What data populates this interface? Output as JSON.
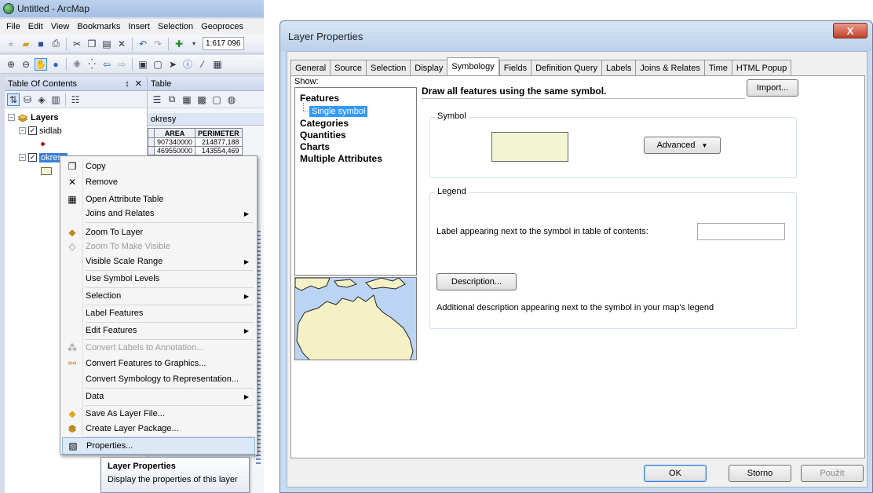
{
  "arcmap": {
    "title": "Untitled - ArcMap",
    "menus": [
      "File",
      "Edit",
      "View",
      "Bookmarks",
      "Insert",
      "Selection",
      "Geoproces"
    ],
    "scale": "1:617 096",
    "toc": {
      "title": "Table Of Contents",
      "controls": "↕ ✕",
      "root": "Layers",
      "layers": [
        "sidlab",
        "okresy"
      ]
    },
    "table": {
      "title": "Table",
      "tab": "okresy",
      "columns": [
        "AREA",
        "PERIMETER"
      ],
      "rows": [
        [
          "907340000",
          "214877,188"
        ],
        [
          "469550000",
          "143554,469"
        ]
      ]
    }
  },
  "context_menu": {
    "items": [
      {
        "label": "Copy"
      },
      {
        "label": "Remove"
      },
      {
        "label": "Open Attribute Table"
      },
      {
        "label": "Joins and Relates"
      },
      {
        "label": "Zoom To Layer"
      },
      {
        "label": "Zoom To Make Visible"
      },
      {
        "label": "Visible Scale Range"
      },
      {
        "label": "Use Symbol Levels"
      },
      {
        "label": "Selection"
      },
      {
        "label": "Label Features"
      },
      {
        "label": "Edit Features"
      },
      {
        "label": "Convert Labels to Annotation..."
      },
      {
        "label": "Convert Features to Graphics..."
      },
      {
        "label": "Convert Symbology to Representation..."
      },
      {
        "label": "Data"
      },
      {
        "label": "Save As Layer File..."
      },
      {
        "label": "Create Layer Package..."
      },
      {
        "label": "Properties..."
      }
    ]
  },
  "tooltip": {
    "title": "Layer Properties",
    "body": "Display the properties of this layer"
  },
  "dialog": {
    "title": "Layer Properties",
    "close": "X",
    "tabs": [
      "General",
      "Source",
      "Selection",
      "Display",
      "Symbology",
      "Fields",
      "Definition Query",
      "Labels",
      "Joins & Relates",
      "Time",
      "HTML Popup"
    ],
    "active_tab": "Symbology",
    "show_label": "Show:",
    "show": {
      "features": "Features",
      "single_symbol": "Single symbol",
      "categories": "Categories",
      "quantities": "Quantities",
      "charts": "Charts",
      "multiple_attributes": "Multiple Attributes"
    },
    "description": "Draw all features using the same symbol.",
    "import": "Import...",
    "symbol_legend": "Symbol",
    "symbol_color": "#f2f5d2",
    "advanced": "Advanced",
    "legend_legend": "Legend",
    "label_prompt": "Label appearing next to the symbol in table of contents:",
    "label_value": "",
    "description_button": "Description...",
    "description_hint": "Additional description appearing next to the symbol in your map's legend",
    "buttons": {
      "ok": "OK",
      "cancel": "Storno",
      "apply": "Použít"
    }
  },
  "colors": {
    "selection_blue": "#3399ff",
    "symbol_fill": "#f2f5d2",
    "close_red": "#c2402a"
  }
}
